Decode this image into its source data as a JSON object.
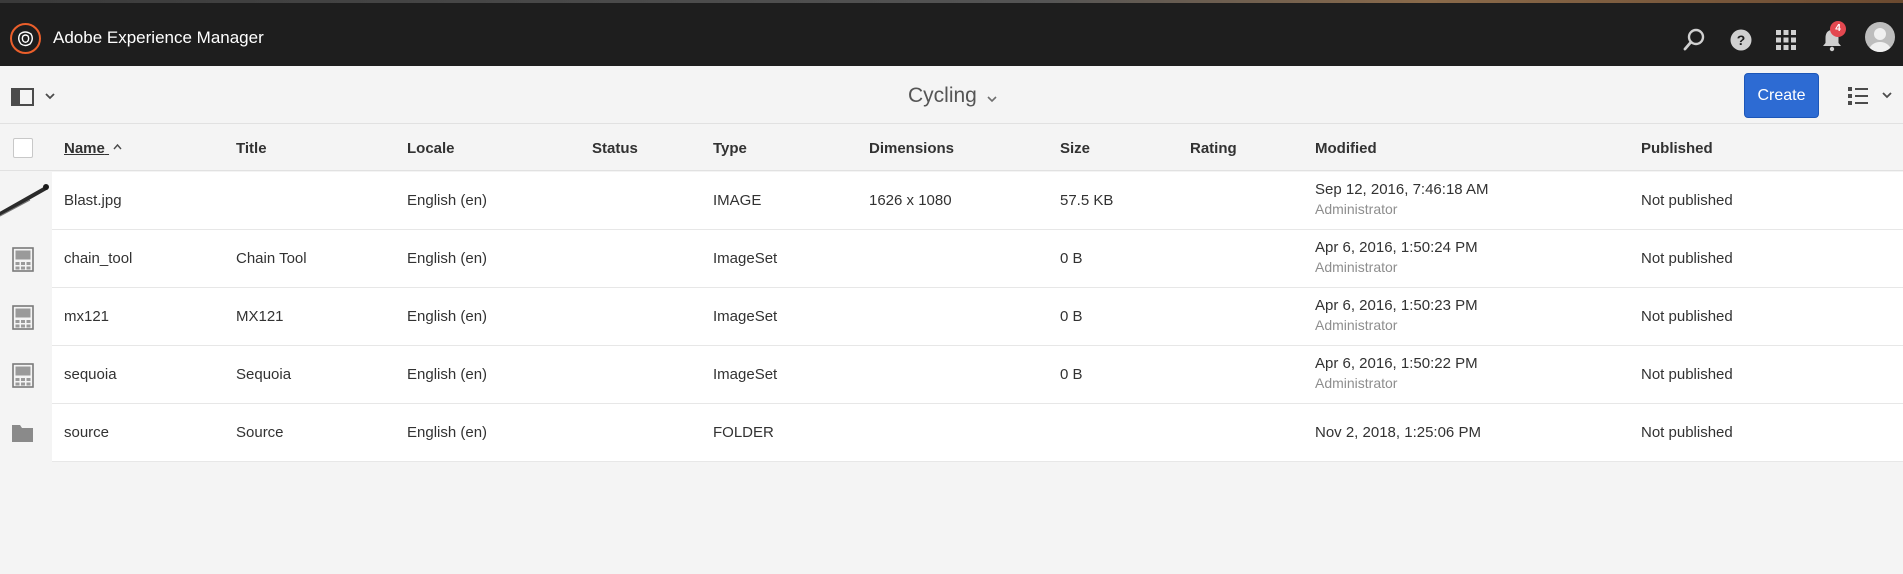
{
  "shell": {
    "brand_name": "Adobe Experience Manager",
    "notification_count": "4",
    "accent": "#eb5f2b",
    "icons": [
      "search-icon",
      "help-icon",
      "solutions-grid-icon",
      "bell-icon",
      "user-avatar"
    ]
  },
  "actionbar": {
    "title": "Cycling",
    "create_label": "Create",
    "create_color": "#2d6bd3",
    "rail_icon": "rail-toggle-icon",
    "view_icon": "list-view-icon"
  },
  "columns": {
    "name": "Name",
    "title": "Title",
    "locale": "Locale",
    "status": "Status",
    "type": "Type",
    "dimensions": "Dimensions",
    "size": "Size",
    "rating": "Rating",
    "modified": "Modified",
    "published": "Published"
  },
  "rows": [
    {
      "name": "Blast.jpg",
      "title": "",
      "locale": "English (en)",
      "status": "",
      "type": "IMAGE",
      "dimensions": "1626 x 1080",
      "size": "57.5 KB",
      "rating": "",
      "modified": "Sep 12, 2016, 7:46:18 AM",
      "modified_by": "Administrator",
      "published": "Not published",
      "thumb": "image-thumbnail"
    },
    {
      "name": "chain_tool",
      "title": "Chain Tool",
      "locale": "English (en)",
      "status": "",
      "type": "ImageSet",
      "dimensions": "",
      "size": "0 B",
      "rating": "",
      "modified": "Apr 6, 2016, 1:50:24 PM",
      "modified_by": "Administrator",
      "published": "Not published",
      "thumb": "imageset-icon"
    },
    {
      "name": "mx121",
      "title": "MX121",
      "locale": "English (en)",
      "status": "",
      "type": "ImageSet",
      "dimensions": "",
      "size": "0 B",
      "rating": "",
      "modified": "Apr 6, 2016, 1:50:23 PM",
      "modified_by": "Administrator",
      "published": "Not published",
      "thumb": "imageset-icon"
    },
    {
      "name": "sequoia",
      "title": "Sequoia",
      "locale": "English (en)",
      "status": "",
      "type": "ImageSet",
      "dimensions": "",
      "size": "0 B",
      "rating": "",
      "modified": "Apr 6, 2016, 1:50:22 PM",
      "modified_by": "Administrator",
      "published": "Not published",
      "thumb": "imageset-icon"
    },
    {
      "name": "source",
      "title": "Source",
      "locale": "English (en)",
      "status": "",
      "type": "FOLDER",
      "dimensions": "",
      "size": "",
      "rating": "",
      "modified": "Nov 2, 2018, 1:25:06 PM",
      "modified_by": "",
      "published": "Not published",
      "thumb": "folder-icon"
    }
  ]
}
